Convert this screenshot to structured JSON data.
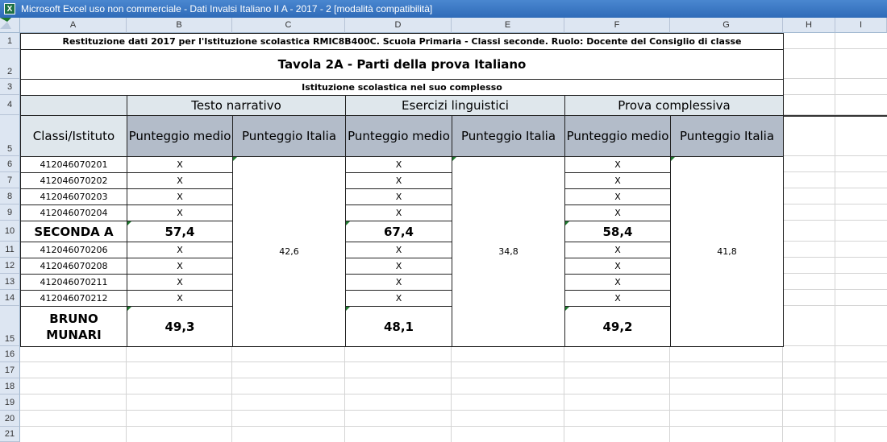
{
  "window": {
    "title": "Microsoft Excel uso non commerciale - Dati Invalsi Italiano II A - 2017 - 2  [modalità compatibilità]",
    "icon": "excel-icon"
  },
  "columns": [
    "A",
    "B",
    "C",
    "D",
    "E",
    "F",
    "G",
    "H",
    "I"
  ],
  "rows": [
    "1",
    "2",
    "3",
    "4",
    "5",
    "6",
    "7",
    "8",
    "9",
    "10",
    "11",
    "12",
    "13",
    "14",
    "15",
    "16",
    "17",
    "18",
    "19",
    "20",
    "21"
  ],
  "sheet": {
    "heading": "Restituzione dati 2017 per l'Istituzione scolastica RMIC8B400C. Scuola Primaria - Classi seconde. Ruolo: Docente del Consiglio di classe",
    "table_title": "Tavola 2A - Parti della prova Italiano",
    "subtitle": "Istituzione scolastica nel suo complesso",
    "sections": [
      "Testo narrativo",
      "Esercizi linguistici",
      "Prova complessiva"
    ],
    "col_headers": [
      "Classi/Istituto",
      "Punteggio medio",
      "Punteggio Italia",
      "Punteggio medio",
      "Punteggio Italia",
      "Punteggio medio",
      "Punteggio Italia"
    ],
    "italia_values": [
      "42,6",
      "34,8",
      "41,8"
    ],
    "data_rows": [
      {
        "label": "412046070201",
        "vals": [
          "X",
          "X",
          "X"
        ]
      },
      {
        "label": "412046070202",
        "vals": [
          "X",
          "X",
          "X"
        ]
      },
      {
        "label": "412046070203",
        "vals": [
          "X",
          "X",
          "X"
        ]
      },
      {
        "label": "412046070204",
        "vals": [
          "X",
          "X",
          "X"
        ]
      },
      {
        "label": "SECONDA A",
        "vals": [
          "57,4",
          "67,4",
          "58,4"
        ],
        "bold": true
      },
      {
        "label": "412046070206",
        "vals": [
          "X",
          "X",
          "X"
        ]
      },
      {
        "label": "412046070208",
        "vals": [
          "X",
          "X",
          "X"
        ]
      },
      {
        "label": "412046070211",
        "vals": [
          "X",
          "X",
          "X"
        ]
      },
      {
        "label": "412046070212",
        "vals": [
          "X",
          "X",
          "X"
        ]
      },
      {
        "label": "BRUNO MUNARI",
        "vals": [
          "49,3",
          "48,1",
          "49,2"
        ],
        "bold": true
      }
    ]
  }
}
